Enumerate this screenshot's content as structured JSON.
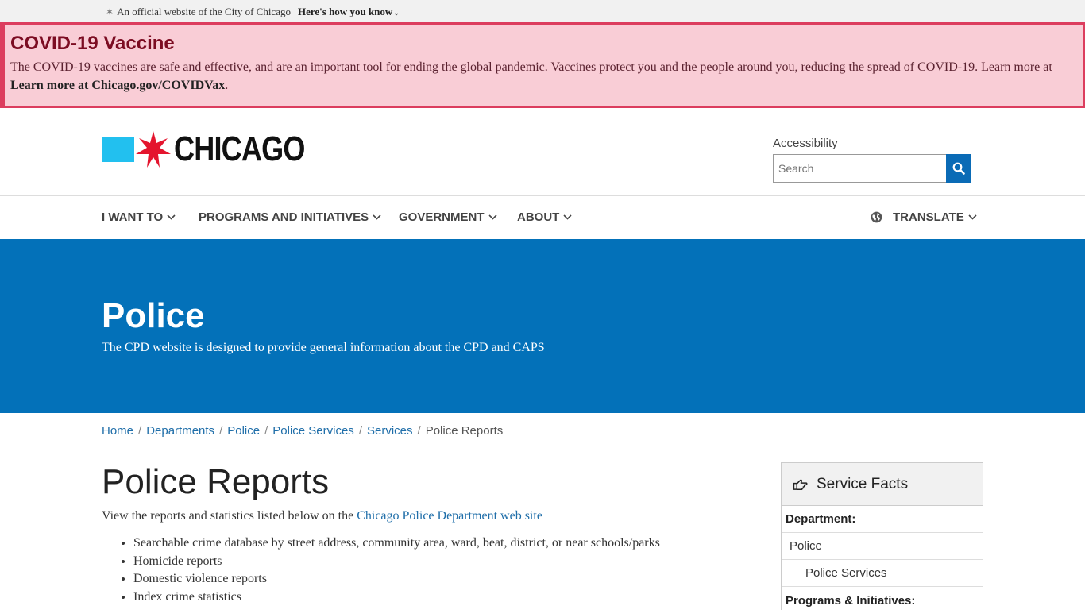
{
  "official_bar": {
    "text": "An official website of the City of Chicago",
    "how_label": "Here's how you know"
  },
  "alert": {
    "title": "COVID-19 Vaccine",
    "body": "The COVID-19 vaccines are safe and effective, and are an important tool for ending the global pandemic. Vaccines protect you and the people around you, reducing the spread of COVID-19. Learn more at ",
    "link": "Learn more at Chicago.gov/COVIDVax",
    "trailing": ".",
    "bg_color": "#f9cdd6",
    "border_color": "#dc3d5e"
  },
  "header": {
    "logo_text": "CHICAGO",
    "accessibility": "Accessibility",
    "search_placeholder": "Search"
  },
  "nav": {
    "items": [
      "I WANT TO",
      "PROGRAMS AND INITIATIVES",
      "GOVERNMENT",
      "ABOUT"
    ],
    "translate": "TRANSLATE"
  },
  "hero": {
    "title": "Police",
    "subtitle": "The CPD website is designed to provide general information about the CPD and CAPS",
    "bg_color": "#0371b9"
  },
  "breadcrumb": {
    "items": [
      "Home",
      "Departments",
      "Police",
      "Police Services",
      "Services"
    ],
    "current": "Police Reports"
  },
  "main": {
    "title": "Police Reports",
    "intro": "View the reports and statistics listed below on the ",
    "intro_link": "Chicago Police Department web site",
    "bullets": [
      "Searchable crime database by street address, community area, ward, beat, district, or near schools/parks",
      "Homicide reports",
      "Domestic violence reports",
      "Index crime statistics"
    ]
  },
  "sidebar": {
    "title": "Service Facts",
    "department_label": "Department:",
    "department": "Police",
    "sub_department": "Police Services",
    "programs_label": "Programs & Initiatives:"
  },
  "icons": {
    "search": "search-icon",
    "globe": "globe-icon",
    "chevron": "chevron-down-icon",
    "hand": "hand-pointing-icon",
    "star": "chicago-star-icon"
  }
}
